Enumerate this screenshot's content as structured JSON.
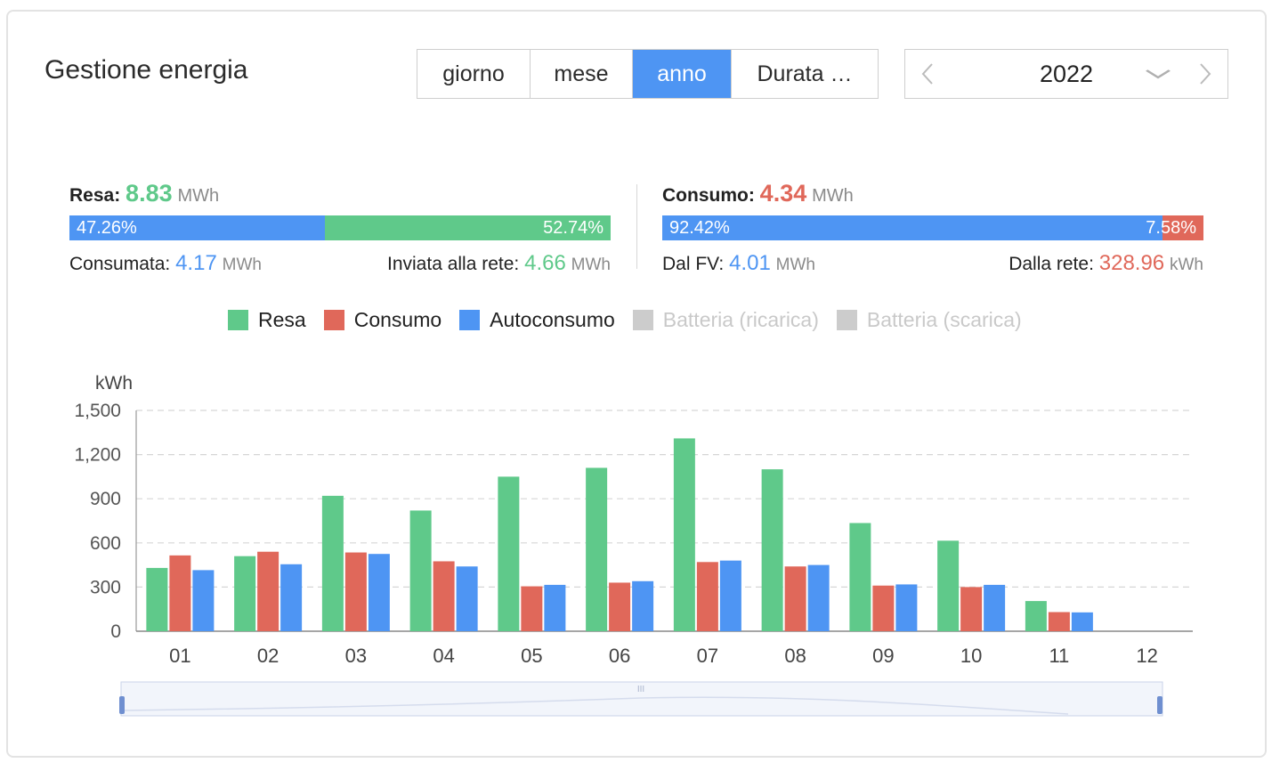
{
  "header": {
    "title": "Gestione energia"
  },
  "period_tabs": [
    {
      "label": "giorno",
      "active": false
    },
    {
      "label": "mese",
      "active": false
    },
    {
      "label": "anno",
      "active": true
    },
    {
      "label": "Durata …",
      "active": false
    }
  ],
  "year_picker": {
    "value": "2022",
    "prev_icon": "chevron-left-icon",
    "next_icon": "chevron-right-icon",
    "dropdown_icon": "chevron-down-icon"
  },
  "yield": {
    "label": "Resa:",
    "value": "8.83",
    "unit": "MWh",
    "left_pct": "47.26%",
    "right_pct": "52.74%",
    "left_fraction": 0.4726,
    "consumed_label": "Consumata:",
    "consumed_value": "4.17",
    "consumed_unit": "MWh",
    "grid_label": "Inviata alla rete:",
    "grid_value": "4.66",
    "grid_unit": "MWh"
  },
  "consumption": {
    "label": "Consumo:",
    "value": "4.34",
    "unit": "MWh",
    "left_pct": "92.42%",
    "right_pct": "7.58%",
    "left_fraction": 0.9242,
    "pv_label": "Dal FV:",
    "pv_value": "4.01",
    "pv_unit": "MWh",
    "grid_label": "Dalla rete:",
    "grid_value": "328.96",
    "grid_unit": "kWh"
  },
  "colors": {
    "green": "#5fc98a",
    "red": "#e0685a",
    "blue": "#4e95f3",
    "disabled": "#cccccc"
  },
  "legend": [
    {
      "label": "Resa",
      "color": "#5fc98a",
      "enabled": true
    },
    {
      "label": "Consumo",
      "color": "#e0685a",
      "enabled": true
    },
    {
      "label": "Autoconsumo",
      "color": "#4e95f3",
      "enabled": true
    },
    {
      "label": "Batteria (ricarica)",
      "color": "#cccccc",
      "enabled": false
    },
    {
      "label": "Batteria (scarica)",
      "color": "#cccccc",
      "enabled": false
    }
  ],
  "chart_data": {
    "type": "bar",
    "ylabel": "kWh",
    "ylim": [
      0,
      1500
    ],
    "yticks": [
      "0",
      "300",
      "600",
      "900",
      "1,200",
      "1,500"
    ],
    "grid": true,
    "categories": [
      "01",
      "02",
      "03",
      "04",
      "05",
      "06",
      "07",
      "08",
      "09",
      "10",
      "11",
      "12"
    ],
    "series": [
      {
        "name": "Resa",
        "color": "#5fc98a",
        "values": [
          430,
          510,
          920,
          820,
          1050,
          1110,
          1310,
          1100,
          735,
          615,
          205,
          0
        ]
      },
      {
        "name": "Consumo",
        "color": "#e0685a",
        "values": [
          515,
          540,
          535,
          475,
          305,
          330,
          470,
          440,
          310,
          300,
          130,
          0
        ]
      },
      {
        "name": "Autoconsumo",
        "color": "#4e95f3",
        "values": [
          415,
          455,
          525,
          440,
          315,
          340,
          480,
          450,
          318,
          315,
          128,
          0
        ]
      }
    ]
  }
}
